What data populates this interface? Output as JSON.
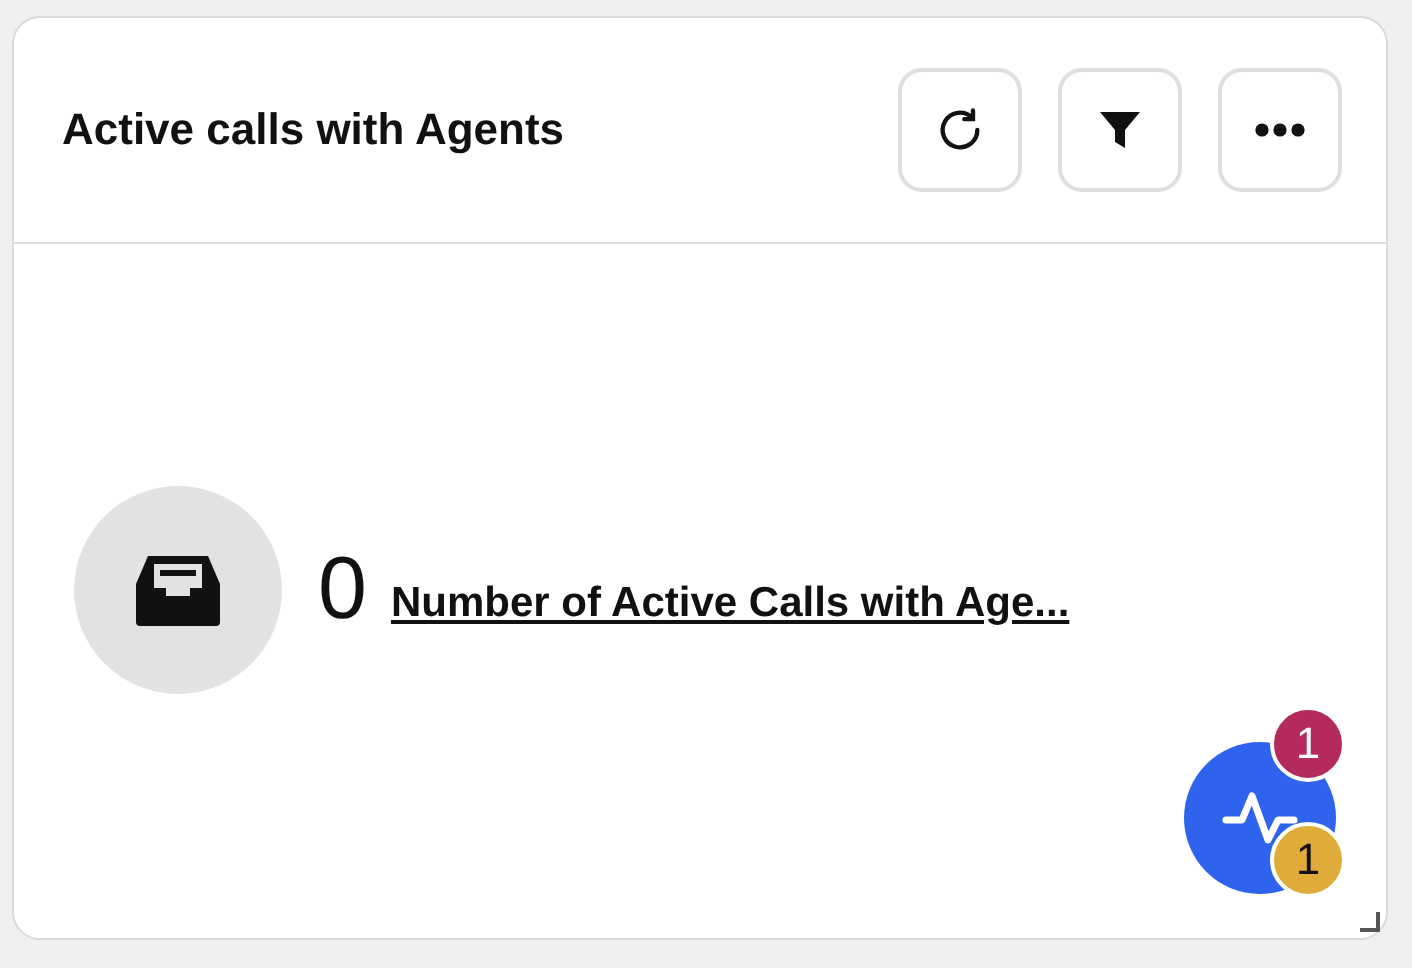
{
  "widget": {
    "title": "Active calls with Agents",
    "actions": [
      {
        "kind": "refresh"
      },
      {
        "kind": "filter"
      },
      {
        "kind": "more"
      }
    ]
  },
  "metric": {
    "value": "0",
    "label": "Number of Active Calls with Age..."
  },
  "activity_button": {
    "badges": [
      {
        "count": "1",
        "color": "#b52a5c"
      },
      {
        "count": "1",
        "color": "#e0ab38"
      }
    ]
  }
}
